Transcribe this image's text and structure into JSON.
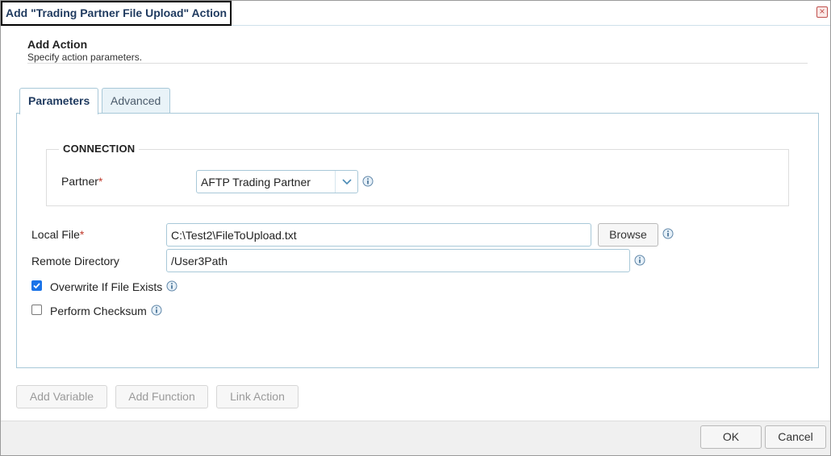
{
  "window": {
    "title": "Add \"Trading Partner File Upload\" Action",
    "close_icon": "close-icon"
  },
  "header": {
    "title": "Add Action",
    "subtitle": "Specify action parameters."
  },
  "tabs": [
    {
      "label": "Parameters",
      "active": true
    },
    {
      "label": "Advanced",
      "active": false
    }
  ],
  "connection": {
    "legend": "CONNECTION",
    "partner_label": "Partner",
    "partner_value": "AFTP Trading Partner"
  },
  "fields": {
    "local_file_label": "Local File",
    "local_file_value": "C:\\Test2\\FileToUpload.txt",
    "browse_label": "Browse",
    "remote_dir_label": "Remote Directory",
    "remote_dir_value": "/User3Path",
    "overwrite_label": "Overwrite If File Exists",
    "overwrite_checked": true,
    "checksum_label": "Perform Checksum",
    "checksum_checked": false
  },
  "required_marker": "*",
  "toolbar": {
    "add_variable": "Add Variable",
    "add_function": "Add Function",
    "link_action": "Link Action"
  },
  "footer": {
    "ok": "OK",
    "cancel": "Cancel"
  },
  "colors": {
    "accent": "#1a73e8",
    "border": "#a8c8d8",
    "required": "#c0392b",
    "title_text": "#1f3a5f"
  }
}
